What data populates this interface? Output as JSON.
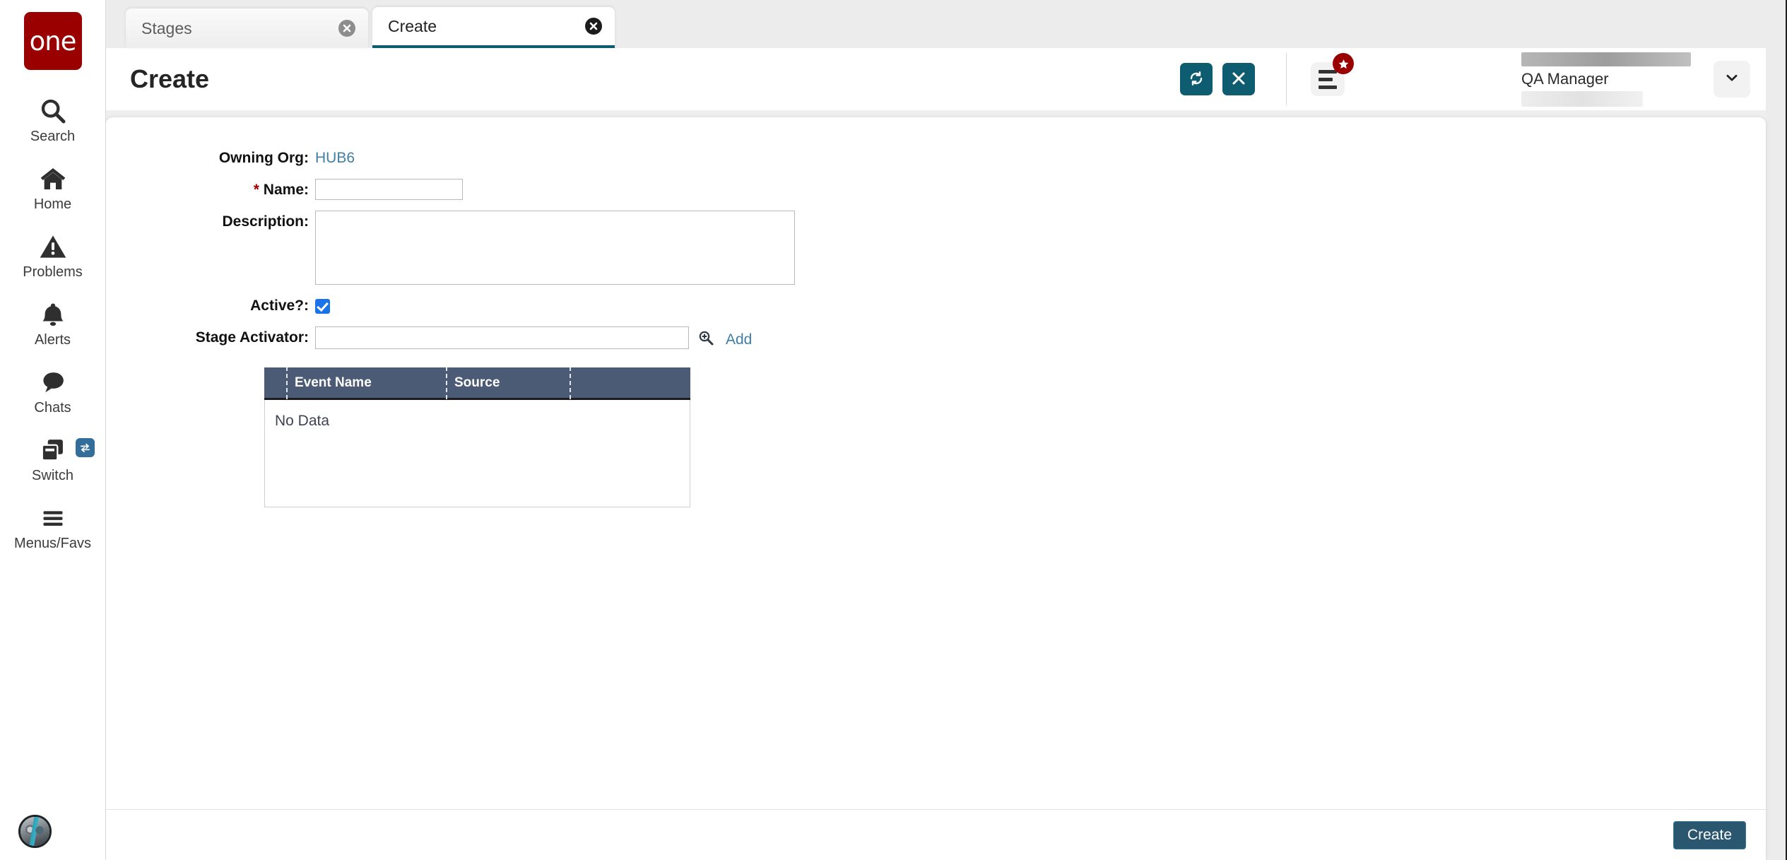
{
  "brand": {
    "logo_text": "one"
  },
  "sidebar": {
    "items": [
      {
        "label": "Search",
        "icon": "search-icon"
      },
      {
        "label": "Home",
        "icon": "home-icon"
      },
      {
        "label": "Problems",
        "icon": "warning-triangle-icon"
      },
      {
        "label": "Alerts",
        "icon": "bell-icon"
      },
      {
        "label": "Chats",
        "icon": "chat-bubble-icon"
      },
      {
        "label": "Switch",
        "icon": "switch-windows-icon",
        "badge_icon": "swap-arrows-icon"
      },
      {
        "label": "Menus/Favs",
        "icon": "hamburger-icon"
      }
    ],
    "avatar": "user-avatar"
  },
  "tabs": [
    {
      "label": "Stages",
      "active": false,
      "close_icon": "close-circle-icon"
    },
    {
      "label": "Create",
      "active": true,
      "close_icon": "close-circle-icon"
    }
  ],
  "header": {
    "title": "Create",
    "refresh_icon": "refresh-icon",
    "close_icon": "close-x-icon",
    "menu_icon": "list-menu-icon",
    "star_badge_icon": "star-icon",
    "profile_role": "QA Manager",
    "caret_icon": "chevron-down-icon"
  },
  "form": {
    "owning_org_label": "Owning Org:",
    "owning_org_value": "HUB6",
    "name_required_marker": "*",
    "name_label": "Name:",
    "name_value": "",
    "name_placeholder": "",
    "description_label": "Description:",
    "description_value": "",
    "description_placeholder": "",
    "active_label": "Active?:",
    "active_checked": true,
    "stage_activator_label": "Stage Activator:",
    "stage_activator_value": "",
    "stage_activator_placeholder": "",
    "lookup_icon": "search-plus-icon",
    "add_link": "Add"
  },
  "grid": {
    "columns": [
      "",
      "Event Name",
      "Source",
      ""
    ],
    "rows": [],
    "empty_text": "No Data"
  },
  "footer": {
    "create_label": "Create"
  },
  "colors": {
    "brand_red": "#9b0000",
    "teal": "#0d5c70",
    "grid_header": "#4b5b76",
    "primary_button": "#2b5670",
    "link": "#3f7fa6",
    "checkbox": "#1a73e8"
  }
}
